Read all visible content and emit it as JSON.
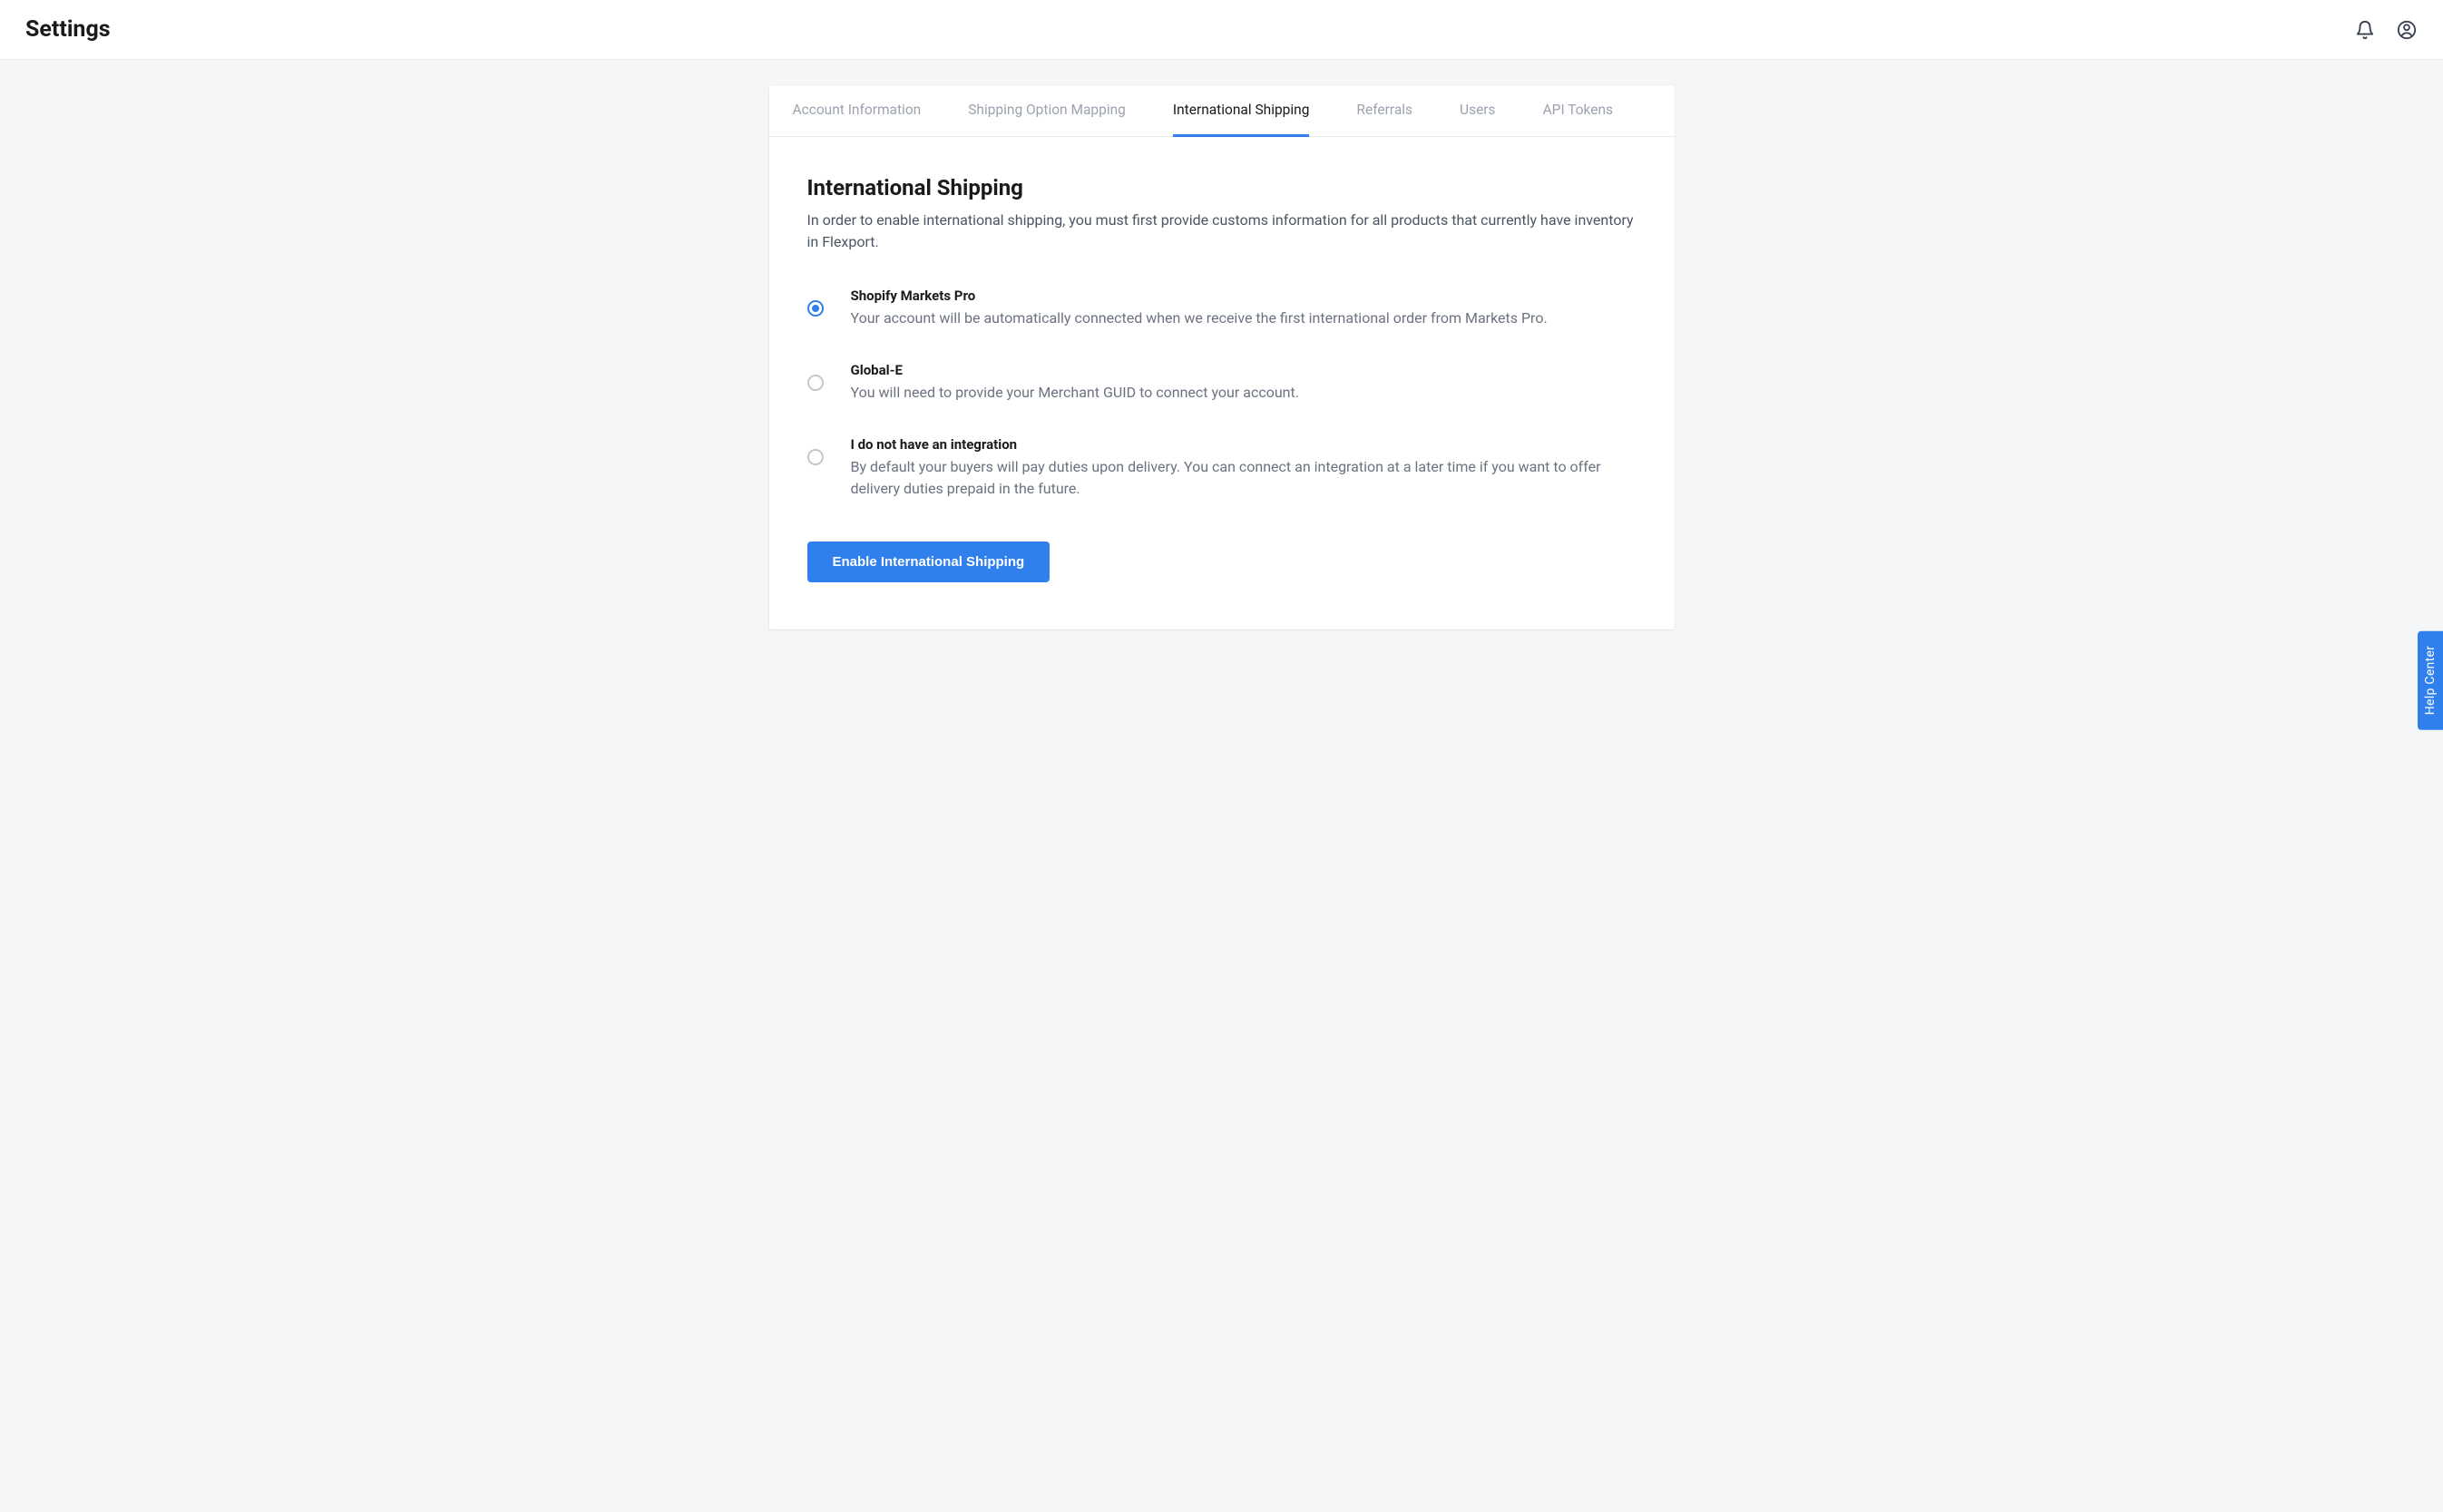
{
  "header": {
    "title": "Settings"
  },
  "tabs": [
    {
      "label": "Account Information",
      "active": false
    },
    {
      "label": "Shipping Option Mapping",
      "active": false
    },
    {
      "label": "International Shipping",
      "active": true
    },
    {
      "label": "Referrals",
      "active": false
    },
    {
      "label": "Users",
      "active": false
    },
    {
      "label": "API Tokens",
      "active": false
    }
  ],
  "section": {
    "title": "International Shipping",
    "description": "In order to enable international shipping, you must first provide customs information for all products that currently have inventory in Flexport."
  },
  "options": [
    {
      "title": "Shopify Markets Pro",
      "description": "Your account will be automatically connected when we receive the first international order from Markets Pro.",
      "selected": true
    },
    {
      "title": "Global-E",
      "description": "You will need to provide your Merchant GUID to connect your account.",
      "selected": false
    },
    {
      "title": "I do not have an integration",
      "description": "By default your buyers will pay duties upon delivery. You can connect an integration at a later time if you want to offer delivery duties prepaid in the future.",
      "selected": false
    }
  ],
  "cta": {
    "label": "Enable International Shipping"
  },
  "help": {
    "label": "Help Center"
  }
}
